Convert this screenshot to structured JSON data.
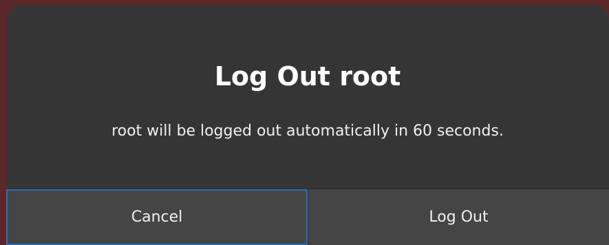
{
  "dialog": {
    "title": "Log Out root",
    "message": "root will be logged out automatically in 60 seconds.",
    "buttons": {
      "cancel_label": "Cancel",
      "logout_label": "Log Out"
    }
  },
  "colors": {
    "dialog_bg": "#353535",
    "button_bg": "#454545",
    "focus_ring": "#2f6db5",
    "backdrop": "#5a2828",
    "text": "#ffffff"
  }
}
